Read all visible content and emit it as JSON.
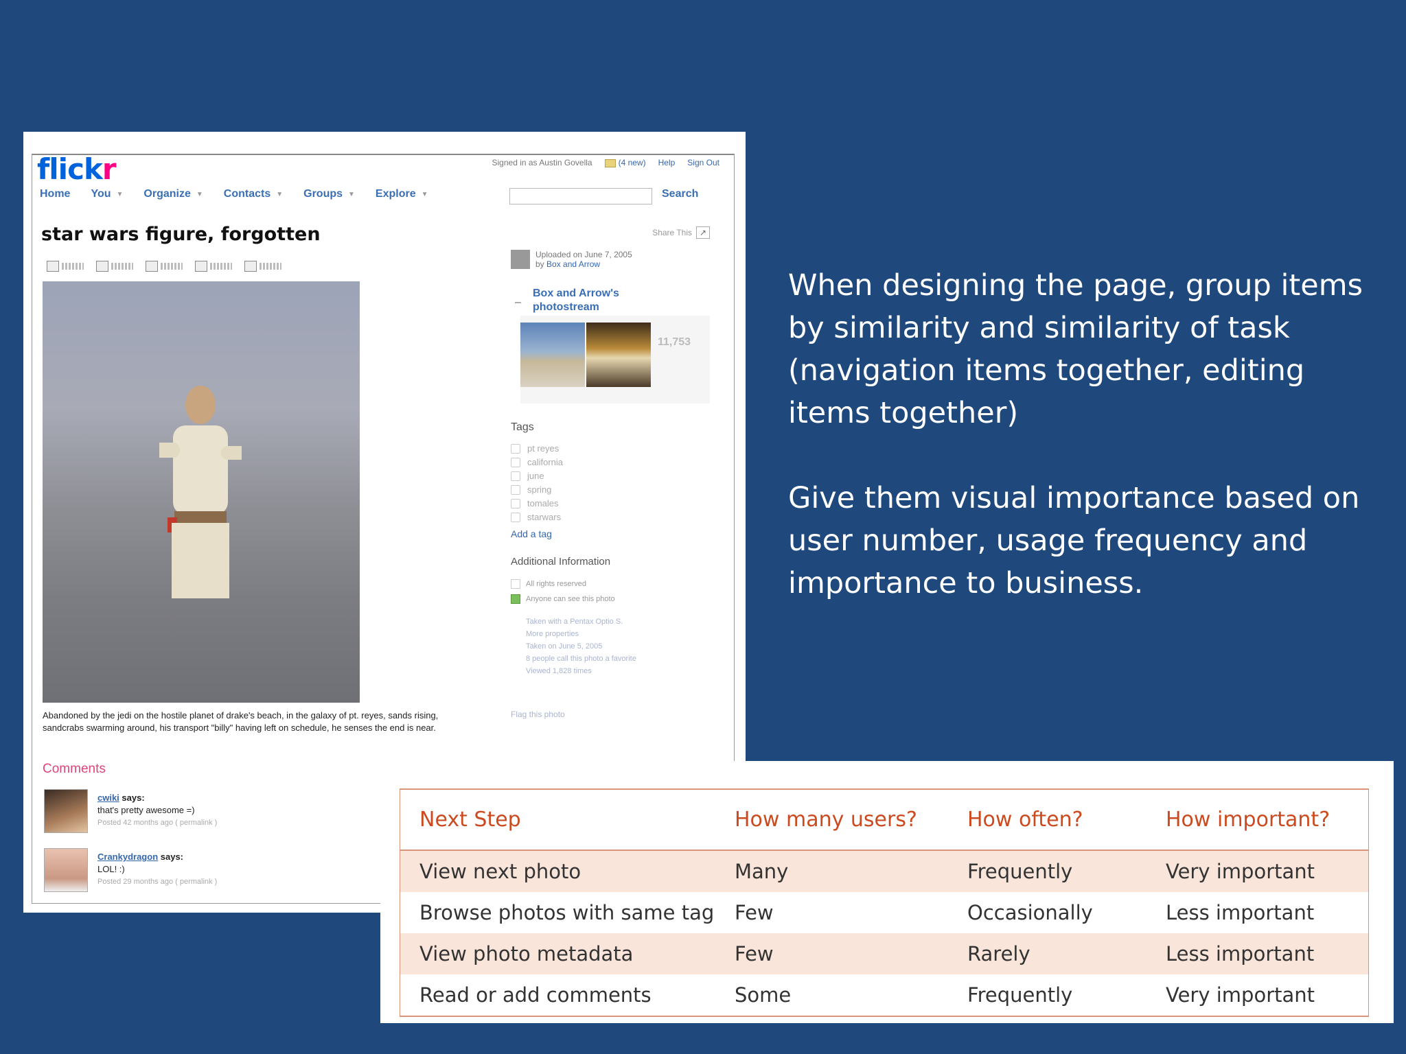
{
  "slide": {
    "paragraph1": "When  designing the page, group items by similarity and similarity of task (navigation items together, editing items together)",
    "paragraph2": "Give them visual importance based on user number, usage frequency and importance to business."
  },
  "flickr": {
    "logo_a": "flick",
    "logo_b": "r",
    "signed_in": "Signed in as Austin Govella",
    "mail": "(4 new)",
    "help": "Help",
    "sign_out": "Sign Out",
    "nav": [
      "Home",
      "You",
      "Organize",
      "Contacts",
      "Groups",
      "Explore"
    ],
    "search_label": "Search",
    "share_this": "Share This",
    "photo_title": "star wars figure, forgotten",
    "caption": "Abandoned by the jedi on the hostile planet of drake's beach, in the galaxy of pt. reyes, sands rising, sandcrabs swarming around, his transport \"billy\" having left on schedule, he senses the end is near.",
    "comments_heading": "Comments",
    "comments": [
      {
        "user": "cwiki",
        "says": "says:",
        "text": "that's pretty awesome =)",
        "meta": "Posted 42 months ago ( permalink )"
      },
      {
        "user": "Crankydragon",
        "says": "says:",
        "text": "LOL! :)",
        "meta": "Posted 29 months ago ( permalink )"
      }
    ],
    "uploaded_line1": "Uploaded on June 7, 2005",
    "uploaded_line2_prefix": "by ",
    "uploaded_by": "Box and Arrow",
    "photostream_title": "Box and Arrow's photostream",
    "photostream_count": "11,753",
    "tags_heading": "Tags",
    "tags": [
      "pt reyes",
      "california",
      "june",
      "spring",
      "tomales",
      "starwars"
    ],
    "add_tag": "Add a tag",
    "additional_heading": "Additional Information",
    "additional_rows": [
      "All rights reserved",
      "Anyone can see this photo"
    ],
    "additional_list": [
      "Taken with a Pentax Optio S.",
      "More properties",
      "Taken on June 5, 2005",
      "8 people call this photo a favorite",
      "Viewed 1,828 times"
    ],
    "flag": "Flag this photo"
  },
  "table": {
    "headers": [
      "Next Step",
      "How many users?",
      "How often?",
      "How important?"
    ],
    "rows": [
      [
        "View next photo",
        "Many",
        "Frequently",
        "Very important"
      ],
      [
        "Browse photos with same tag",
        "Few",
        "Occasionally",
        "Less important"
      ],
      [
        "View photo metadata",
        "Few",
        "Rarely",
        "Less important"
      ],
      [
        "Read or add comments",
        "Some",
        "Frequently",
        "Very important"
      ]
    ]
  }
}
